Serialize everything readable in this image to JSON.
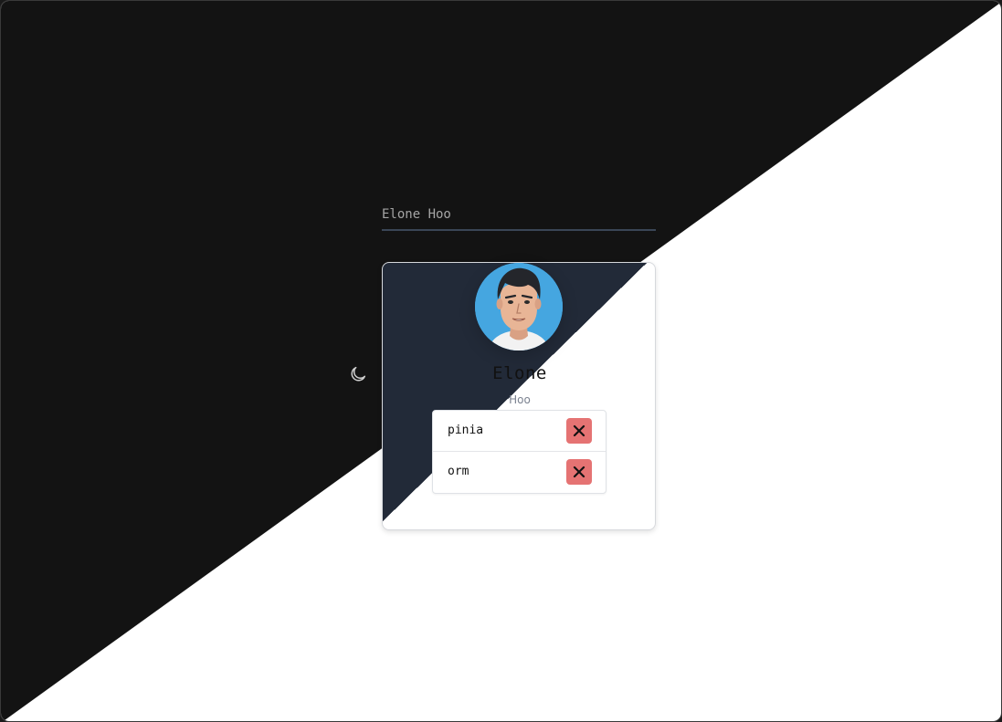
{
  "profile": {
    "name_input_value": "Elone Hoo",
    "first_name": "Elone",
    "last_name": "Hoo"
  },
  "tags": [
    {
      "label": "pinia",
      "remove_icon": "close-icon"
    },
    {
      "label": "orm",
      "remove_icon": "close-icon"
    }
  ],
  "theme_toggle": {
    "icon": "moon-icon"
  },
  "colors": {
    "dark_background": "#131313",
    "light_background": "#ffffff",
    "card_dark": "#222a38",
    "avatar_background": "#45a6e0",
    "remove_button": "#e57373"
  }
}
